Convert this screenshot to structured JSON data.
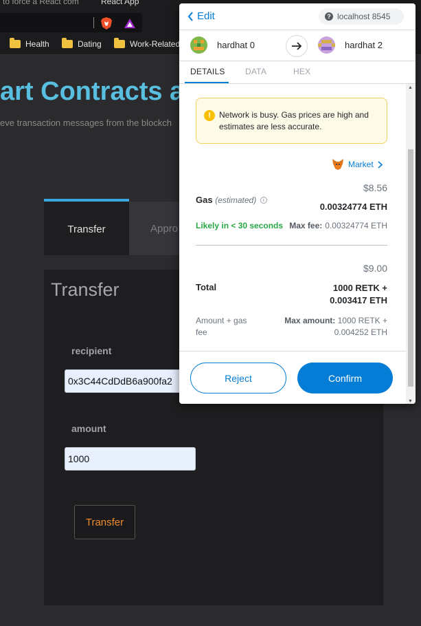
{
  "browser": {
    "tabs": [
      "to force a React com",
      "React App"
    ],
    "bookmarks": [
      "Health",
      "Dating",
      "Work-Related"
    ]
  },
  "page": {
    "title": "art Contracts a",
    "subtitle": "eve transaction messages from the blockch",
    "tabs": [
      "Transfer",
      "Appro"
    ],
    "card_title": "Transfer",
    "recipient_label": "recipient",
    "recipient_value": "0x3C44CdDdB6a900fa2",
    "amount_label": "amount",
    "amount_value": "1000",
    "transfer_button": "Transfer"
  },
  "popup": {
    "edit_label": "Edit",
    "network": "localhost 8545",
    "from_account": "hardhat 0",
    "to_account": "hardhat 2",
    "tabs": [
      "DETAILS",
      "DATA",
      "HEX"
    ],
    "active_tab": "DETAILS",
    "warning": "Network is busy. Gas prices are high and estimates are less accurate.",
    "market_label": "Market",
    "gas_label": "Gas",
    "gas_estimated": "(estimated)",
    "gas_usd": "$8.56",
    "gas_eth": "0.00324774 ETH",
    "likely": "Likely in < 30 seconds",
    "max_fee_label": "Max fee:",
    "max_fee_value": "0.00324774 ETH",
    "total_usd": "$9.00",
    "total_label": "Total",
    "total_line1": "1000 RETK +",
    "total_line2": "0.003417 ETH",
    "amount_gas_label": "Amount + gas fee",
    "max_amount_label": "Max amount:",
    "max_amount_value": "1000 RETK + 0.004252 ETH",
    "reject_label": "Reject",
    "confirm_label": "Confirm",
    "colors": {
      "primary": "#037dd6",
      "success": "#28a745",
      "warning_bg": "#fefae8"
    }
  }
}
